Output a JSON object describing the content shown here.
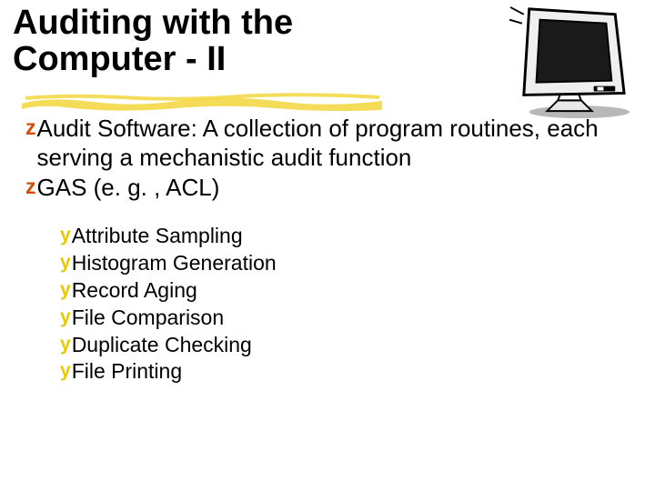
{
  "slide": {
    "title_line1": "Auditing with the",
    "title_line2": "Computer - II",
    "main_bullets": [
      {
        "marker": "z",
        "text": "Audit Software: A collection of program routines, each serving a mechanistic audit function"
      },
      {
        "marker": "z",
        "text": "GAS (e. g. , ACL)"
      }
    ],
    "sub_bullets": [
      {
        "marker": "y",
        "text": "Attribute Sampling"
      },
      {
        "marker": "y",
        "text": "Histogram Generation"
      },
      {
        "marker": "y",
        "text": "Record Aging"
      },
      {
        "marker": "y",
        "text": "File Comparison"
      },
      {
        "marker": "y",
        "text": "Duplicate Checking"
      },
      {
        "marker": "y",
        "text": "File Printing"
      }
    ],
    "bullet_markers": {
      "z": "z",
      "y": "y"
    },
    "colors": {
      "z_bullet": "#d84a00",
      "y_bullet": "#e8c800",
      "highlight": "#f4d94a"
    }
  }
}
